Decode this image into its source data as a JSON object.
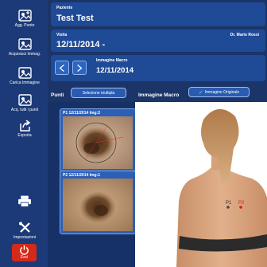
{
  "sidebar": {
    "items": [
      {
        "label": "Agg. Punto",
        "icon": "add-point-icon"
      },
      {
        "label": "Acquisisci Immag.",
        "icon": "acquire-image-icon"
      },
      {
        "label": "Carica Immagine",
        "icon": "load-image-icon"
      },
      {
        "label": "Acq. tutti i punti",
        "icon": "acquire-all-icon"
      },
      {
        "label": "Esporta",
        "icon": "export-icon"
      }
    ],
    "print_icon": "printer-icon",
    "settings_label": "Impostazioni",
    "exit_label": "Esci"
  },
  "patient": {
    "caption": "Paziente",
    "name": "Test Test"
  },
  "visit": {
    "caption": "Visita",
    "value": "12/11/2014 -",
    "doctor": "Dr. Mario Rossi"
  },
  "macro": {
    "caption": "Immagine Macro",
    "date": "12/11/2014"
  },
  "points": {
    "label": "Punti",
    "multi_select_label": "Selezione multipla",
    "macro_label": "Immagine Macro",
    "original_label": "Immagine Originale",
    "thumbnails": [
      {
        "caption": "P1  12/11/2014  Img:2"
      },
      {
        "caption": "P2  12/11/2014  Img:1"
      }
    ]
  },
  "body_markers": [
    "P1",
    "P2"
  ],
  "colors": {
    "sidebar": "#1c3a78",
    "panel": "#1f4a96",
    "exit": "#d32a1a",
    "accent": "#2c65c2"
  }
}
